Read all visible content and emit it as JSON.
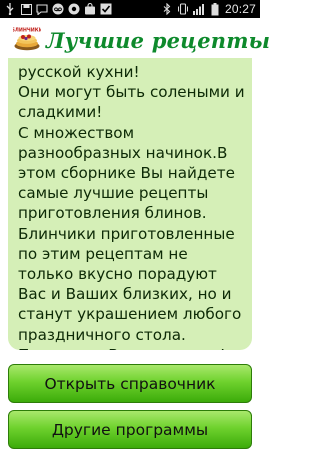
{
  "status_bar": {
    "left_icons": [
      "usb-icon",
      "save-icon",
      "message-icon",
      "voicemail-icon",
      "recorder-icon",
      "shopping-bag-icon",
      "checkbox-icon"
    ],
    "right_icons": [
      "bluetooth-icon",
      "vibrate-icon",
      "signal-icon",
      "battery-icon"
    ],
    "time": "20:27"
  },
  "header": {
    "logo_text": "БЛИНЧИКИ",
    "title": "Лучшие рецепты"
  },
  "content": {
    "text": "русской кухни!\nОни могут быть солеными и сладкими!\nС множеством разнообразных начинок.В этом сборнике Вы найдете самые лучшие рецепты приготовления блинов.\nБлинчики приготовленные по этим рецептам не только вкусно порадуют Вас и Ваших близких, но и станут украшением любого праздничного стола.\nПриятного Вам аппетита!"
  },
  "buttons": {
    "open_reference": "Открыть справочник",
    "other_programs": "Другие программы"
  },
  "colors": {
    "title_green": "#0e8a2c",
    "panel_bg": "#d5efb7",
    "button_green": "#6fd22e"
  }
}
